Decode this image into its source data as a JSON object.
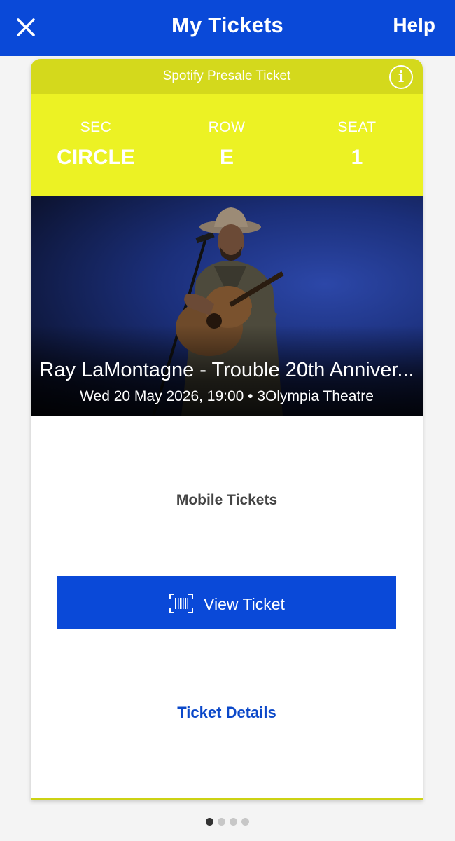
{
  "topbar": {
    "title": "My Tickets",
    "help_label": "Help",
    "close_icon": "close-icon",
    "bg_color": "#0a49d8"
  },
  "ticket": {
    "header_label": "Spotify Presale Ticket",
    "info_icon": "info-icon",
    "header_color": "#d4d91c",
    "seat_band_color": "#ecf224",
    "section": {
      "label": "SEC",
      "value": "CIRCLE"
    },
    "row": {
      "label": "ROW",
      "value": "E"
    },
    "seat": {
      "label": "SEAT",
      "value": "1"
    },
    "event_title": "Ray LaMontagne - Trouble 20th Anniver...",
    "event_meta": "Wed 20 May 2026, 19:00 • 3Olympia Theatre",
    "mobile_tickets_label": "Mobile Tickets",
    "view_ticket_label": "View Ticket",
    "view_ticket_icon": "barcode-icon",
    "ticket_details_label": "Ticket Details"
  },
  "pager": {
    "total": 4,
    "active_index": 0
  }
}
